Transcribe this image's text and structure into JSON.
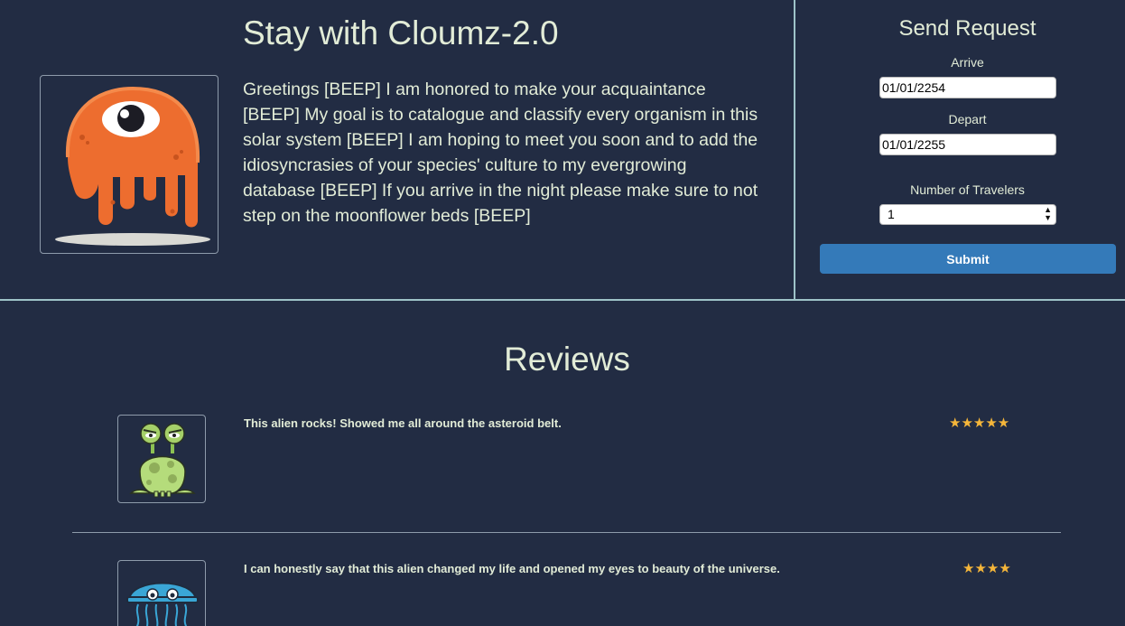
{
  "host": {
    "title": "Stay with Cloumz-2.0",
    "bio": "Greetings [BEEP] I am honored to make your acquaintance [BEEP] My goal is to catalogue and classify every organism in this solar system [BEEP] I am hoping to meet you soon and to add the idiosyncrasies of your species' culture to my evergrowing database [BEEP] If you arrive in the night please make sure to not step on the moonflower beds [BEEP]",
    "avatar_icon": "orange-one-eyed-alien-icon"
  },
  "request": {
    "title": "Send Request",
    "arrive_label": "Arrive",
    "arrive_value": "01/01/2254",
    "depart_label": "Depart",
    "depart_value": "01/01/2255",
    "travelers_label": "Number of Travelers",
    "travelers_value": "1",
    "submit_label": "Submit",
    "submit_color": "#347ab9"
  },
  "reviews": {
    "title": "Reviews",
    "items": [
      {
        "text": "This alien rocks! Showed me all around the asteroid belt.",
        "rating": 5,
        "stars": "★★★★★",
        "avatar_icon": "green-antenna-alien-icon"
      },
      {
        "text": "I can honestly say that this alien changed my life and opened my eyes to beauty of the universe.",
        "rating": 4,
        "stars": "★★★★",
        "avatar_icon": "blue-jellyfish-alien-icon"
      }
    ]
  },
  "colors": {
    "background": "#222c43",
    "text": "#e2ecd7",
    "border": "#9ec3c8",
    "star": "#f5b63a"
  }
}
